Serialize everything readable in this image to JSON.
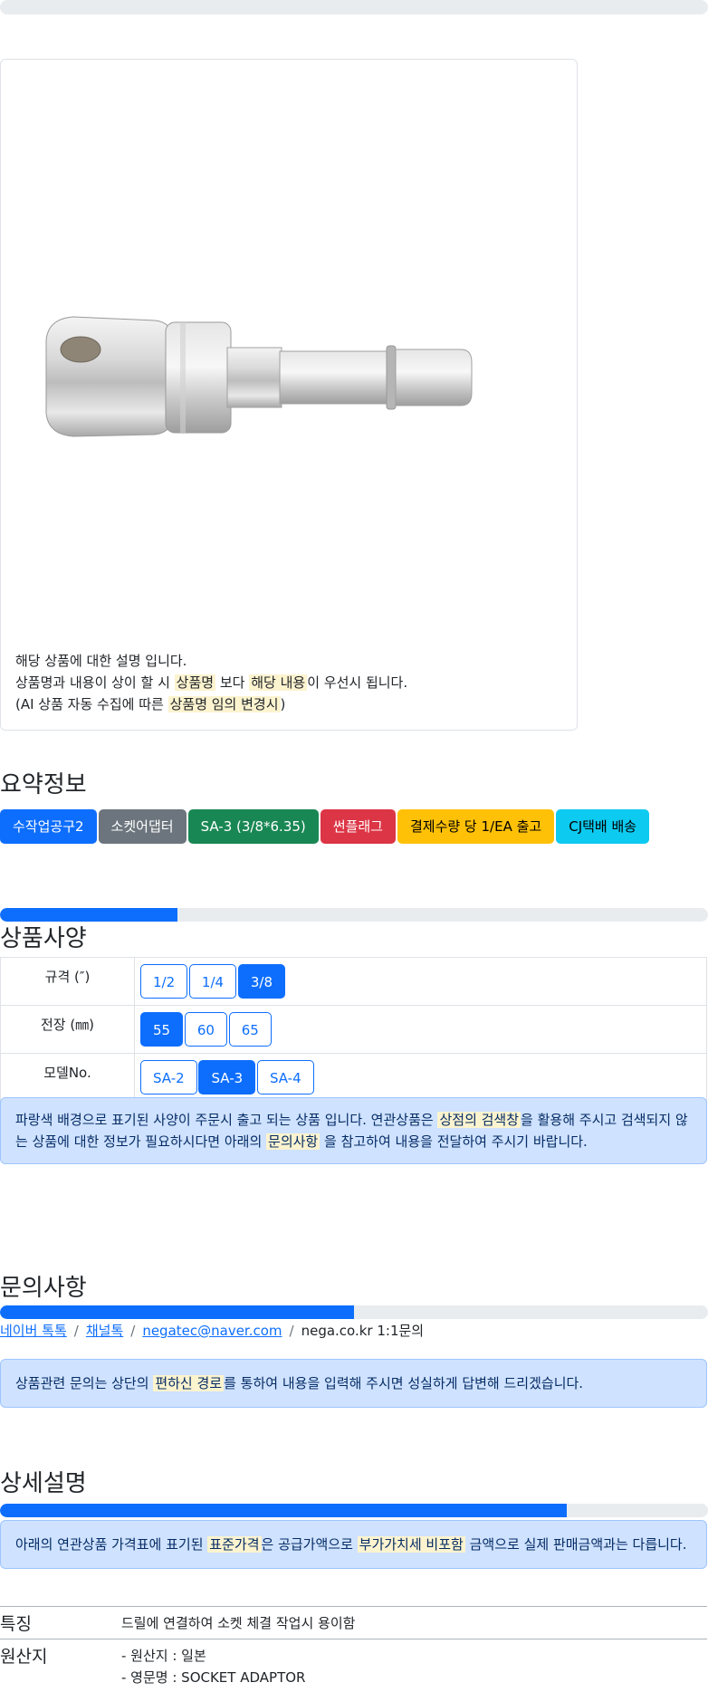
{
  "product": {
    "image_alt": "socket adaptor",
    "desc": {
      "line1": "해당 상품에 대한 설명 입니다.",
      "line2_pre": "상품명과 내용이 상이 할 시",
      "line2_mark1": "상품명",
      "line2_mid": "보다",
      "line2_mark2": "해당 내용",
      "line2_post": "이 우선시 됩니다.",
      "line3_pre": "(AI 상품 자동 수집에 따른",
      "line3_mark": "상품명 임의 변경시",
      "line3_post": ")"
    }
  },
  "summary": {
    "title": "요약정보",
    "badges": [
      {
        "label": "수작업공구2",
        "color": "#0d6efd",
        "text_color": "#ffffff"
      },
      {
        "label": "소켓어댑터",
        "color": "#6c757d",
        "text_color": "#ffffff"
      },
      {
        "label": "SA-3 (3/8*6.35)",
        "color": "#198754",
        "text_color": "#ffffff"
      },
      {
        "label": "썬플래그",
        "color": "#dc3545",
        "text_color": "#ffffff"
      },
      {
        "label": "결제수량 당 1/EA 출고",
        "color": "#ffc107",
        "text_color": "#000000"
      },
      {
        "label": "CJ택배 배송",
        "color": "#0dcaf0",
        "text_color": "#000000"
      }
    ]
  },
  "spec": {
    "title": "상품사양",
    "progress": 0.25,
    "rows": [
      {
        "label": "규격 (″)",
        "options": [
          "1/2",
          "1/4",
          "3/8"
        ],
        "active": 2
      },
      {
        "label": "전장 (㎜)",
        "options": [
          "55",
          "60",
          "65"
        ],
        "active": 0
      },
      {
        "label": "모델No.",
        "options": [
          "SA-2",
          "SA-3",
          "SA-4"
        ],
        "active": 1
      }
    ],
    "notice": {
      "pre": "파랑색 배경으로 표기된 사양이 주문시 출고 되는 상품 입니다. 연관상품은",
      "mark1": "상점의 검색창",
      "mid": "을 활용해 주시고 검색되지 않는 상품에 대한 정보가 필요하시다면 아래의",
      "mark2": "문의사항",
      "post": "을 참고하여 내용을 전달하여 주시기 바랍니다."
    }
  },
  "inquiry": {
    "title": "문의사항",
    "progress": 0.5,
    "links": [
      "네이버 톡톡",
      "채널톡",
      "negatec@naver.com"
    ],
    "plain": "nega.co.kr 1:1문의",
    "notice": {
      "pre": "상품관련 문의는 상단의",
      "mark": "편하신 경로",
      "post": "를 통하여 내용을 입력해 주시면 성실하게 답변해 드리겠습니다."
    }
  },
  "detail": {
    "title": "상세설명",
    "progress": 0.8,
    "notice": {
      "pre": "아래의 연관상품 가격표에 표기된",
      "mark1": "표준가격",
      "mid": "은 공급가액으로",
      "mark2": "부가가치세 비포함",
      "post": "금액으로 실제 판매금액과는 다릅니다."
    },
    "features": [
      {
        "label": "특징",
        "lines": [
          "드릴에 연결하여 소켓 체결 작업시 용이함"
        ]
      },
      {
        "label": "원산지",
        "lines": [
          "- 원산지 : 일본",
          "- 영문명 : SOCKET ADAPTOR"
        ]
      }
    ]
  }
}
